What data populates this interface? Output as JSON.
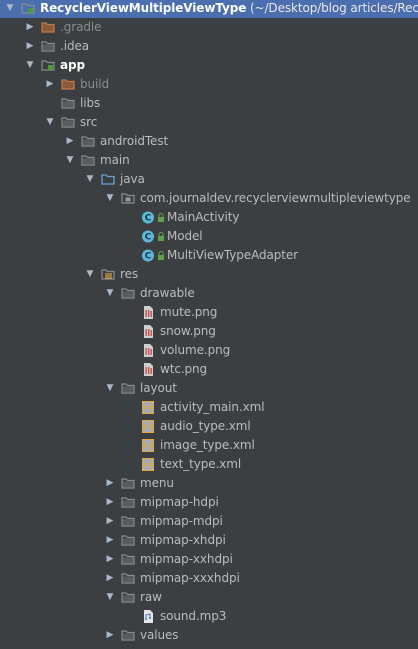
{
  "tree": [
    {
      "depth": 0,
      "arrow": "down",
      "icon": "module-folder-icon",
      "label": "RecyclerViewMultipleViewType",
      "suffix": " (~/Desktop/blog articles/RecyclerViewMultipleViewType)",
      "style": "bold",
      "selected": true
    },
    {
      "depth": 1,
      "arrow": "right",
      "icon": "folder-orange-icon",
      "label": ".gradle",
      "style": "dim"
    },
    {
      "depth": 1,
      "arrow": "right",
      "icon": "folder-icon",
      "label": ".idea",
      "style": "normal"
    },
    {
      "depth": 1,
      "arrow": "down",
      "icon": "module-folder-icon",
      "label": "app",
      "style": "bold-white"
    },
    {
      "depth": 2,
      "arrow": "right",
      "icon": "folder-orange-icon",
      "label": "build",
      "style": "dim"
    },
    {
      "depth": 2,
      "arrow": "none",
      "icon": "folder-icon",
      "label": "libs",
      "style": "normal"
    },
    {
      "depth": 2,
      "arrow": "down",
      "icon": "folder-icon",
      "label": "src",
      "style": "normal"
    },
    {
      "depth": 3,
      "arrow": "right",
      "icon": "folder-icon",
      "label": "androidTest",
      "style": "normal"
    },
    {
      "depth": 3,
      "arrow": "down",
      "icon": "folder-icon",
      "label": "main",
      "style": "normal"
    },
    {
      "depth": 4,
      "arrow": "down",
      "icon": "source-folder-icon",
      "label": "java",
      "style": "normal"
    },
    {
      "depth": 5,
      "arrow": "down",
      "icon": "package-icon",
      "label": "com.journaldev.recyclerviewmultipleviewtype",
      "style": "normal"
    },
    {
      "depth": 6,
      "arrow": "none",
      "icon": "class-icon",
      "label": "MainActivity",
      "style": "normal",
      "lock": true
    },
    {
      "depth": 6,
      "arrow": "none",
      "icon": "class-icon",
      "label": "Model",
      "style": "normal",
      "lock": true
    },
    {
      "depth": 6,
      "arrow": "none",
      "icon": "class-icon",
      "label": "MultiViewTypeAdapter",
      "style": "normal",
      "lock": true
    },
    {
      "depth": 4,
      "arrow": "down",
      "icon": "resources-folder-icon",
      "label": "res",
      "style": "normal"
    },
    {
      "depth": 5,
      "arrow": "down",
      "icon": "folder-icon",
      "label": "drawable",
      "style": "normal"
    },
    {
      "depth": 6,
      "arrow": "none",
      "icon": "png-file-icon",
      "label": "mute.png",
      "style": "normal"
    },
    {
      "depth": 6,
      "arrow": "none",
      "icon": "png-file-icon",
      "label": "snow.png",
      "style": "normal"
    },
    {
      "depth": 6,
      "arrow": "none",
      "icon": "png-file-icon",
      "label": "volume.png",
      "style": "normal"
    },
    {
      "depth": 6,
      "arrow": "none",
      "icon": "png-file-icon",
      "label": "wtc.png",
      "style": "normal"
    },
    {
      "depth": 5,
      "arrow": "down",
      "icon": "folder-icon",
      "label": "layout",
      "style": "normal"
    },
    {
      "depth": 6,
      "arrow": "none",
      "icon": "xml-file-icon",
      "label": "activity_main.xml",
      "style": "normal"
    },
    {
      "depth": 6,
      "arrow": "none",
      "icon": "xml-file-icon",
      "label": "audio_type.xml",
      "style": "normal"
    },
    {
      "depth": 6,
      "arrow": "none",
      "icon": "xml-file-icon",
      "label": "image_type.xml",
      "style": "normal"
    },
    {
      "depth": 6,
      "arrow": "none",
      "icon": "xml-file-icon",
      "label": "text_type.xml",
      "style": "normal"
    },
    {
      "depth": 5,
      "arrow": "right",
      "icon": "folder-icon",
      "label": "menu",
      "style": "normal"
    },
    {
      "depth": 5,
      "arrow": "right",
      "icon": "folder-icon",
      "label": "mipmap-hdpi",
      "style": "normal"
    },
    {
      "depth": 5,
      "arrow": "right",
      "icon": "folder-icon",
      "label": "mipmap-mdpi",
      "style": "normal"
    },
    {
      "depth": 5,
      "arrow": "right",
      "icon": "folder-icon",
      "label": "mipmap-xhdpi",
      "style": "normal"
    },
    {
      "depth": 5,
      "arrow": "right",
      "icon": "folder-icon",
      "label": "mipmap-xxhdpi",
      "style": "normal"
    },
    {
      "depth": 5,
      "arrow": "right",
      "icon": "folder-icon",
      "label": "mipmap-xxxhdpi",
      "style": "normal"
    },
    {
      "depth": 5,
      "arrow": "down",
      "icon": "folder-icon",
      "label": "raw",
      "style": "normal"
    },
    {
      "depth": 6,
      "arrow": "none",
      "icon": "audio-file-icon",
      "label": "sound.mp3",
      "style": "normal"
    },
    {
      "depth": 5,
      "arrow": "right",
      "icon": "folder-icon",
      "label": "values",
      "style": "normal"
    },
    {
      "depth": 5,
      "arrow": "right",
      "icon": "folder-icon",
      "label": "",
      "style": "normal"
    }
  ],
  "colors": {
    "background": "#3c3f41",
    "selection": "#4b6eaf",
    "text": "#bbbbbb",
    "dim_text": "#8c8c8c",
    "folder": "#8d8d8d",
    "folder_orange": "#c07c4e",
    "class_badge": "#5eb9d8",
    "lock": "#61a14a",
    "xml_badge": "#e0a840"
  }
}
